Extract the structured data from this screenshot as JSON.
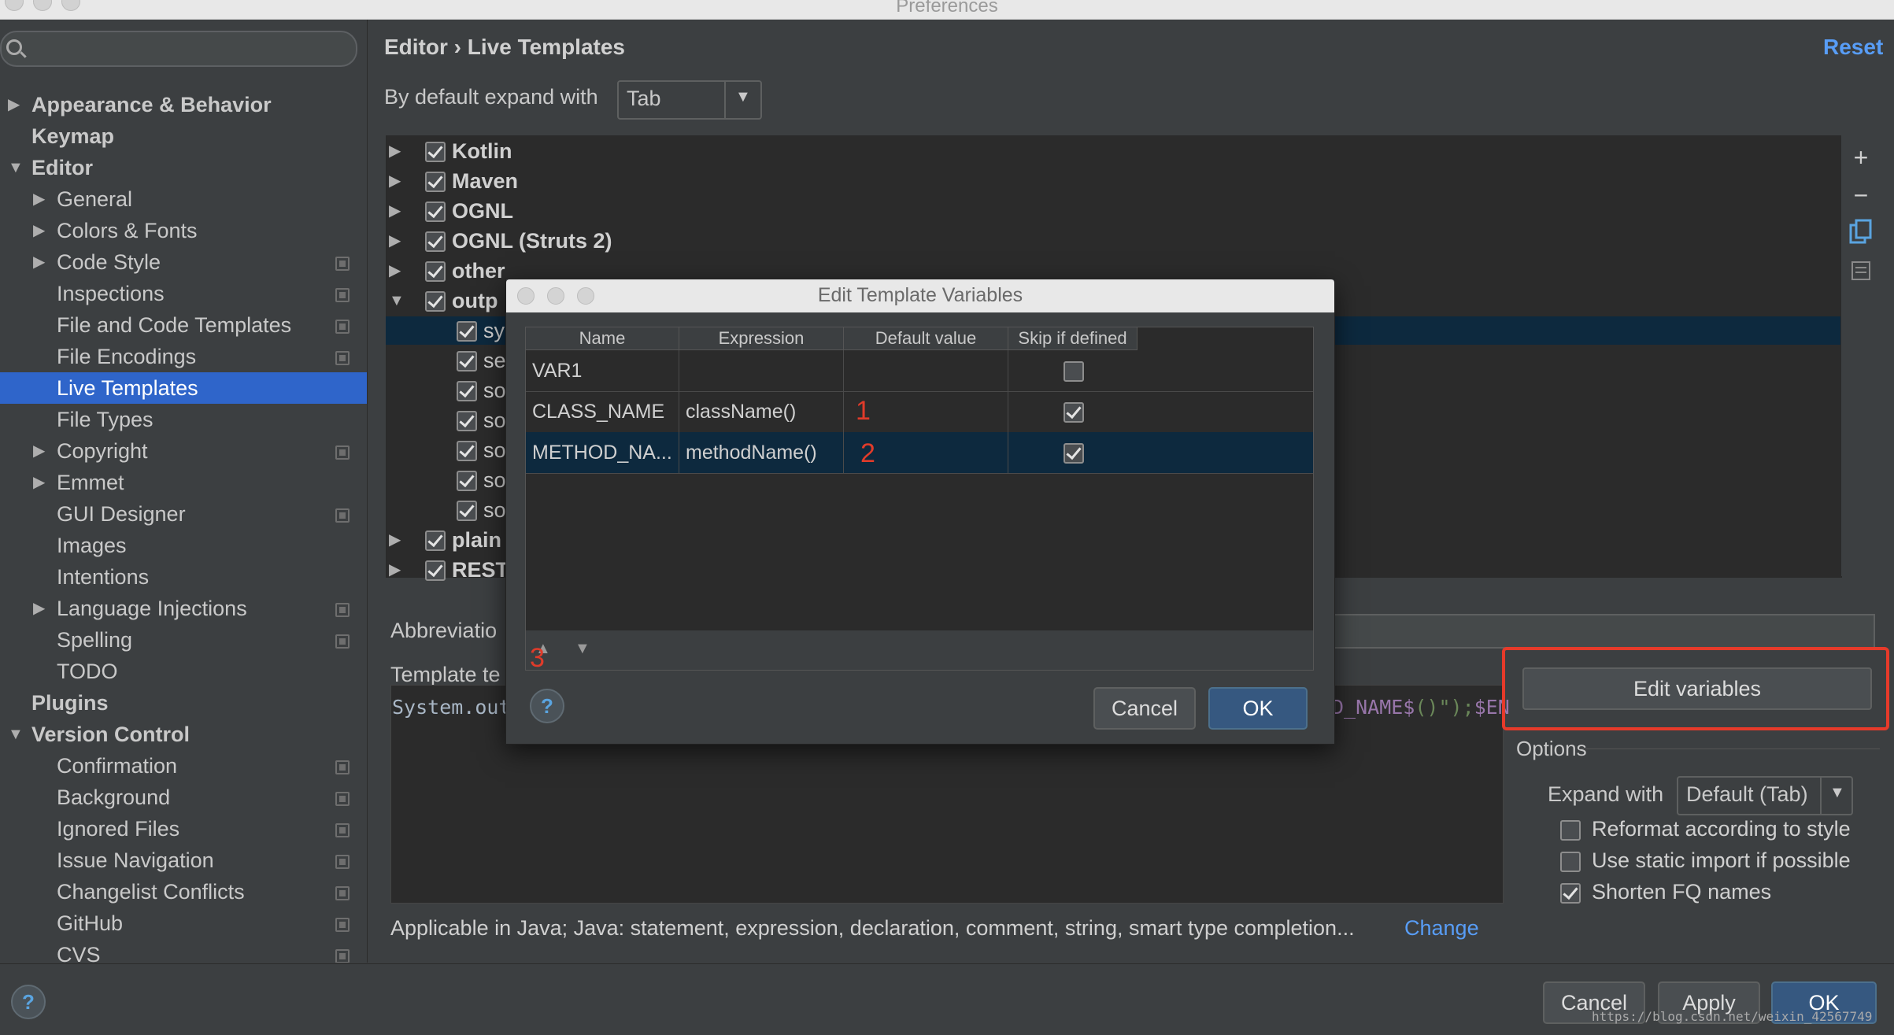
{
  "window": {
    "title": "Preferences"
  },
  "sidebar": {
    "search_placeholder": "",
    "items": [
      {
        "label": "Appearance & Behavior",
        "level": 0,
        "arrow": "▶",
        "bold": true,
        "settings_icon": false
      },
      {
        "label": "Keymap",
        "level": 0,
        "arrow": "",
        "bold": true,
        "settings_icon": false
      },
      {
        "label": "Editor",
        "level": 0,
        "arrow": "▼",
        "bold": true,
        "settings_icon": false
      },
      {
        "label": "General",
        "level": 1,
        "arrow": "▶",
        "bold": false,
        "settings_icon": false
      },
      {
        "label": "Colors & Fonts",
        "level": 1,
        "arrow": "▶",
        "bold": false,
        "settings_icon": false
      },
      {
        "label": "Code Style",
        "level": 1,
        "arrow": "▶",
        "bold": false,
        "settings_icon": true
      },
      {
        "label": "Inspections",
        "level": 1,
        "arrow": "",
        "bold": false,
        "settings_icon": true
      },
      {
        "label": "File and Code Templates",
        "level": 1,
        "arrow": "",
        "bold": false,
        "settings_icon": true
      },
      {
        "label": "File Encodings",
        "level": 1,
        "arrow": "",
        "bold": false,
        "settings_icon": true
      },
      {
        "label": "Live Templates",
        "level": 1,
        "arrow": "",
        "bold": false,
        "settings_icon": false,
        "selected": true
      },
      {
        "label": "File Types",
        "level": 1,
        "arrow": "",
        "bold": false,
        "settings_icon": false
      },
      {
        "label": "Copyright",
        "level": 1,
        "arrow": "▶",
        "bold": false,
        "settings_icon": true
      },
      {
        "label": "Emmet",
        "level": 1,
        "arrow": "▶",
        "bold": false,
        "settings_icon": false
      },
      {
        "label": "GUI Designer",
        "level": 1,
        "arrow": "",
        "bold": false,
        "settings_icon": true
      },
      {
        "label": "Images",
        "level": 1,
        "arrow": "",
        "bold": false,
        "settings_icon": false
      },
      {
        "label": "Intentions",
        "level": 1,
        "arrow": "",
        "bold": false,
        "settings_icon": false
      },
      {
        "label": "Language Injections",
        "level": 1,
        "arrow": "▶",
        "bold": false,
        "settings_icon": true
      },
      {
        "label": "Spelling",
        "level": 1,
        "arrow": "",
        "bold": false,
        "settings_icon": true
      },
      {
        "label": "TODO",
        "level": 1,
        "arrow": "",
        "bold": false,
        "settings_icon": false
      },
      {
        "label": "Plugins",
        "level": 0,
        "arrow": "",
        "bold": true,
        "settings_icon": false
      },
      {
        "label": "Version Control",
        "level": 0,
        "arrow": "▼",
        "bold": true,
        "settings_icon": false
      },
      {
        "label": "Confirmation",
        "level": 1,
        "arrow": "",
        "bold": false,
        "settings_icon": true
      },
      {
        "label": "Background",
        "level": 1,
        "arrow": "",
        "bold": false,
        "settings_icon": true
      },
      {
        "label": "Ignored Files",
        "level": 1,
        "arrow": "",
        "bold": false,
        "settings_icon": true
      },
      {
        "label": "Issue Navigation",
        "level": 1,
        "arrow": "",
        "bold": false,
        "settings_icon": true
      },
      {
        "label": "Changelist Conflicts",
        "level": 1,
        "arrow": "",
        "bold": false,
        "settings_icon": true
      },
      {
        "label": "GitHub",
        "level": 1,
        "arrow": "",
        "bold": false,
        "settings_icon": true
      },
      {
        "label": "CVS",
        "level": 1,
        "arrow": "",
        "bold": false,
        "settings_icon": true
      }
    ]
  },
  "main": {
    "breadcrumb": "Editor › Live Templates",
    "reset_label": "Reset",
    "expand_label": "By default expand with",
    "expand_value": "Tab",
    "template_groups": [
      {
        "label": "Kotlin",
        "arrow": "▶",
        "checked": true,
        "bold": true,
        "level": 0
      },
      {
        "label": "Maven",
        "arrow": "▶",
        "checked": true,
        "bold": true,
        "level": 0
      },
      {
        "label": "OGNL",
        "arrow": "▶",
        "checked": true,
        "bold": true,
        "level": 0
      },
      {
        "label": "OGNL (Struts 2)",
        "arrow": "▶",
        "checked": true,
        "bold": true,
        "level": 0
      },
      {
        "label": "other",
        "arrow": "▶",
        "checked": true,
        "bold": true,
        "level": 0
      },
      {
        "label": "outp",
        "arrow": "▼",
        "checked": true,
        "bold": true,
        "level": 0
      },
      {
        "label": "sy",
        "arrow": "",
        "checked": true,
        "bold": false,
        "level": 1,
        "selected": true
      },
      {
        "label": "se",
        "arrow": "",
        "checked": true,
        "bold": false,
        "level": 1
      },
      {
        "label": "so",
        "arrow": "",
        "checked": true,
        "bold": false,
        "level": 1
      },
      {
        "label": "so",
        "arrow": "",
        "checked": true,
        "bold": false,
        "level": 1
      },
      {
        "label": "so",
        "arrow": "",
        "checked": true,
        "bold": false,
        "level": 1
      },
      {
        "label": "so",
        "arrow": "",
        "checked": true,
        "bold": false,
        "level": 1
      },
      {
        "label": "so",
        "arrow": "",
        "checked": true,
        "bold": false,
        "level": 1
      },
      {
        "label": "plain",
        "arrow": "▶",
        "checked": true,
        "bold": true,
        "level": 0
      },
      {
        "label": "REST",
        "arrow": "▶",
        "checked": true,
        "bold": true,
        "level": 0
      }
    ],
    "toolbar": {
      "add": "+",
      "remove": "−",
      "copy_icon": "copy-icon",
      "restore_icon": "restore-icon"
    },
    "abbreviation_label": "Abbreviatio",
    "template_text_label": "Template te",
    "code_left": "System.out",
    "code_right_var": "D_NAME$",
    "code_right_str": "()\");",
    "code_right_end": "$EN",
    "edit_variables_label": "Edit variables",
    "options_label": "Options",
    "expand_with_label": "Expand with",
    "expand_with_value": "Default (Tab)",
    "options": [
      {
        "label": "Reformat according to style",
        "checked": false
      },
      {
        "label": "Use static import if possible",
        "checked": false
      },
      {
        "label": "Shorten FQ names",
        "checked": true
      }
    ],
    "applicable_text": "Applicable in Java; Java: statement, expression, declaration, comment, string, smart type completion...",
    "change_link": "Change"
  },
  "dialog": {
    "title": "Edit Template Variables",
    "columns": [
      "Name",
      "Expression",
      "Default value",
      "Skip if defined"
    ],
    "rows": [
      {
        "name": "VAR1",
        "expression": "",
        "default": "",
        "skip": false
      },
      {
        "name": "CLASS_NAME",
        "expression": "className()",
        "default": "",
        "skip": true
      },
      {
        "name": "METHOD_NA...",
        "expression": "methodName()",
        "default": "",
        "skip": true,
        "selected": true
      }
    ],
    "annotations": [
      "1",
      "2",
      "3"
    ],
    "help_label": "?",
    "cancel_label": "Cancel",
    "ok_label": "OK"
  },
  "footer": {
    "help_label": "?",
    "cancel_label": "Cancel",
    "apply_label": "Apply",
    "ok_label": "OK",
    "watermark": "https://blog.csdn.net/weixin_42567749"
  },
  "colors": {
    "selection": "#2f65ca",
    "link": "#589df6",
    "highlight_box": "#e63a2a",
    "annotation": "#e03b2a"
  }
}
